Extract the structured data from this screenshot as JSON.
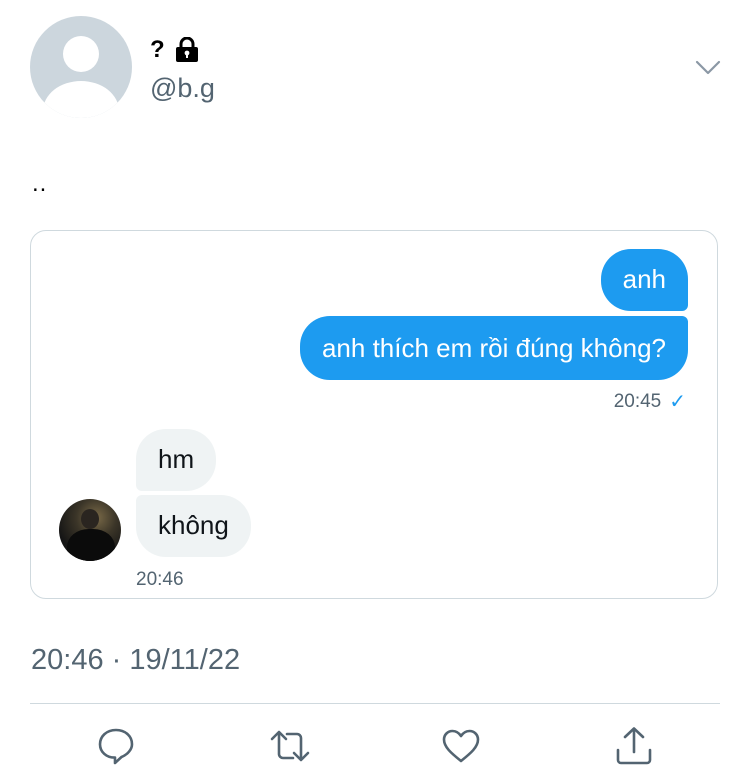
{
  "user": {
    "display_name": "?",
    "handle": "@b.g"
  },
  "tweet": {
    "text": "..",
    "timestamp": "20:46 · 19/11/22"
  },
  "dm_card": {
    "outgoing": {
      "messages": [
        "anh",
        "anh thích em rồi đúng không?"
      ],
      "time": "20:45",
      "status_icon": "check-icon"
    },
    "incoming": {
      "messages": [
        "hm",
        "không"
      ],
      "time": "20:46"
    }
  },
  "actions": [
    "reply-icon",
    "retweet-icon",
    "like-icon",
    "share-icon"
  ],
  "colors": {
    "accent": "#1d9bf0",
    "secondary_text": "#536471",
    "incoming_bubble": "#eff3f4",
    "border": "#cfd9de"
  }
}
